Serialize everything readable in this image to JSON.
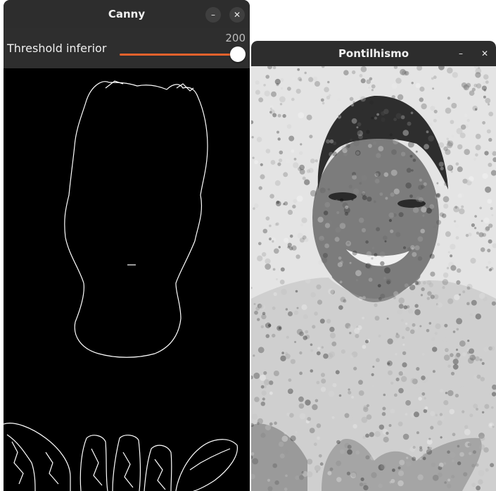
{
  "canny_window": {
    "title": "Canny",
    "minimize_glyph": "–",
    "close_glyph": "✕",
    "trackbar": {
      "label": "Threshold inferior",
      "value": "200",
      "level": 1.0,
      "accent_color": "#e8622c"
    }
  },
  "pontilhismo_window": {
    "title": "Pontilhismo",
    "minimize_glyph": "–",
    "close_glyph": "✕"
  },
  "icons": [
    "minimize-icon",
    "close-icon"
  ]
}
